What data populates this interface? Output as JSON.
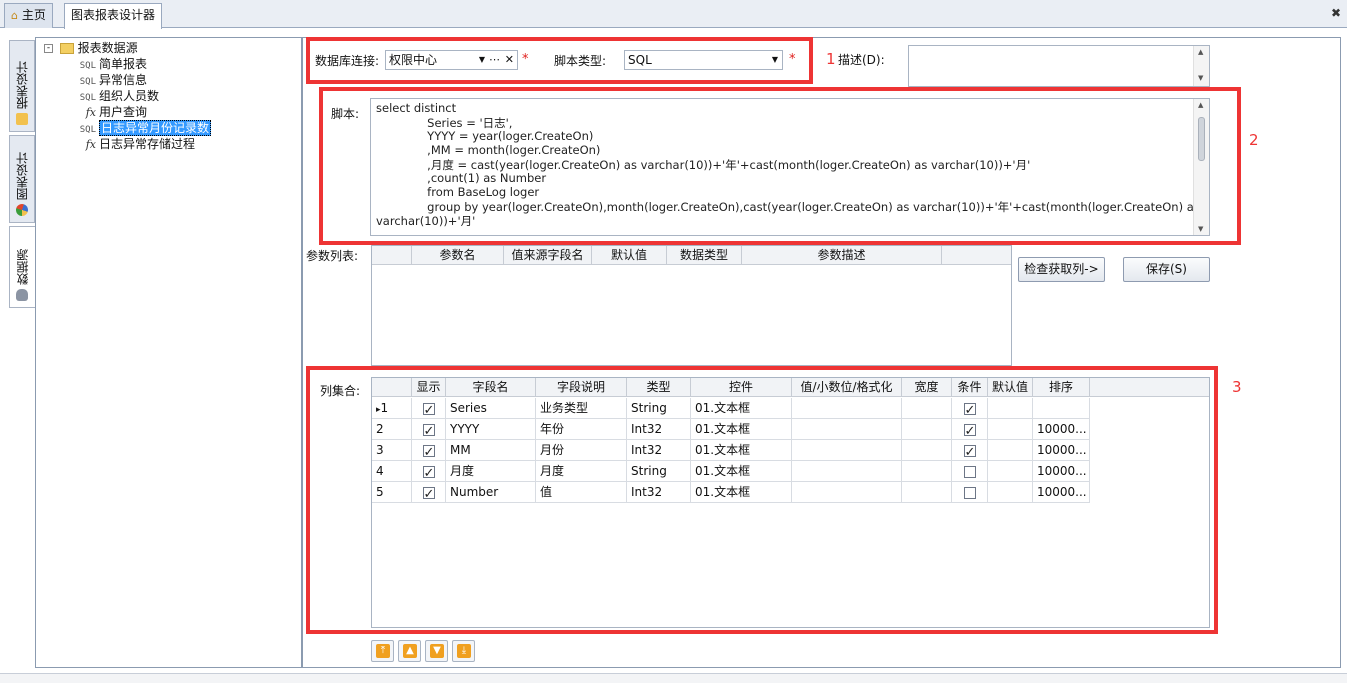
{
  "tabs": [
    {
      "label": "主页",
      "icon": "home-icon"
    },
    {
      "label": "图表报表设计器",
      "active": true
    }
  ],
  "side_tabs": [
    {
      "label": "报表设计",
      "icon": "report-design-icon"
    },
    {
      "label": "图表设计",
      "icon": "pie-chart-icon"
    },
    {
      "label": "数据源",
      "icon": "database-icon",
      "active": true
    }
  ],
  "tree": {
    "root": "报表数据源",
    "items": [
      {
        "prefix": "SQL",
        "label": "简单报表"
      },
      {
        "prefix": "SQL",
        "label": "异常信息"
      },
      {
        "prefix": "SQL",
        "label": "组织人员数"
      },
      {
        "prefix": "fx",
        "label": "用户查询"
      },
      {
        "prefix": "SQL",
        "label": "日志异常月份记录数",
        "selected": true
      },
      {
        "prefix": "fx",
        "label": "日志异常存储过程"
      }
    ]
  },
  "form": {
    "db_label": "数据库连接:",
    "db_value": "权限中心",
    "script_type_label": "脚本类型:",
    "script_type_value": "SQL",
    "required_mark": "*",
    "desc_label": "描述(D):",
    "script_label": "脚本:",
    "script_lines": [
      "select distinct",
      "              Series = '日志',",
      "              YYYY = year(loger.CreateOn)",
      "              ,MM = month(loger.CreateOn)",
      "              ,月度 = cast(year(loger.CreateOn) as varchar(10))+'年'+cast(month(loger.CreateOn) as varchar(10))+'月'",
      "              ,count(1) as Number",
      "              from BaseLog loger",
      "              group by year(loger.CreateOn),month(loger.CreateOn),cast(year(loger.CreateOn) as varchar(10))+'年'+cast(month(loger.CreateOn) as",
      "varchar(10))+'月'"
    ]
  },
  "params": {
    "label": "参数列表:",
    "headers": [
      "参数名",
      "值来源字段名",
      "默认值",
      "数据类型",
      "参数描述"
    ]
  },
  "buttons": {
    "check_columns": "检查获取列->",
    "save": "保存(S)"
  },
  "columns": {
    "label": "列集合:",
    "headers": [
      "显示",
      "字段名",
      "字段说明",
      "类型",
      "控件",
      "值/小数位/格式化",
      "宽度",
      "条件",
      "默认值",
      "排序"
    ],
    "rows": [
      {
        "idx": "1",
        "show": true,
        "field": "Series",
        "desc": "业务类型",
        "type": "String",
        "ctrl": "01.文本框",
        "fmt": "",
        "width": "",
        "cond": true,
        "def": "",
        "sort": "",
        "current": true
      },
      {
        "idx": "2",
        "show": true,
        "field": "YYYY",
        "desc": "年份",
        "type": "Int32",
        "ctrl": "01.文本框",
        "fmt": "",
        "width": "",
        "cond": true,
        "def": "",
        "sort": "10000..."
      },
      {
        "idx": "3",
        "show": true,
        "field": "MM",
        "desc": "月份",
        "type": "Int32",
        "ctrl": "01.文本框",
        "fmt": "",
        "width": "",
        "cond": true,
        "def": "",
        "sort": "10000..."
      },
      {
        "idx": "4",
        "show": true,
        "field": "月度",
        "desc": "月度",
        "type": "String",
        "ctrl": "01.文本框",
        "fmt": "",
        "width": "",
        "cond": false,
        "def": "",
        "sort": "10000..."
      },
      {
        "idx": "5",
        "show": true,
        "field": "Number",
        "desc": "值",
        "type": "Int32",
        "ctrl": "01.文本框",
        "fmt": "",
        "width": "",
        "cond": false,
        "def": "",
        "sort": "10000..."
      }
    ]
  },
  "move_buttons": [
    "move-top-icon",
    "move-up-icon",
    "move-down-icon",
    "move-bottom-icon"
  ],
  "annotations": [
    "1",
    "2",
    "3"
  ],
  "colors": {
    "annotation_red": "#ee3434",
    "selection_blue": "#3399ff"
  }
}
